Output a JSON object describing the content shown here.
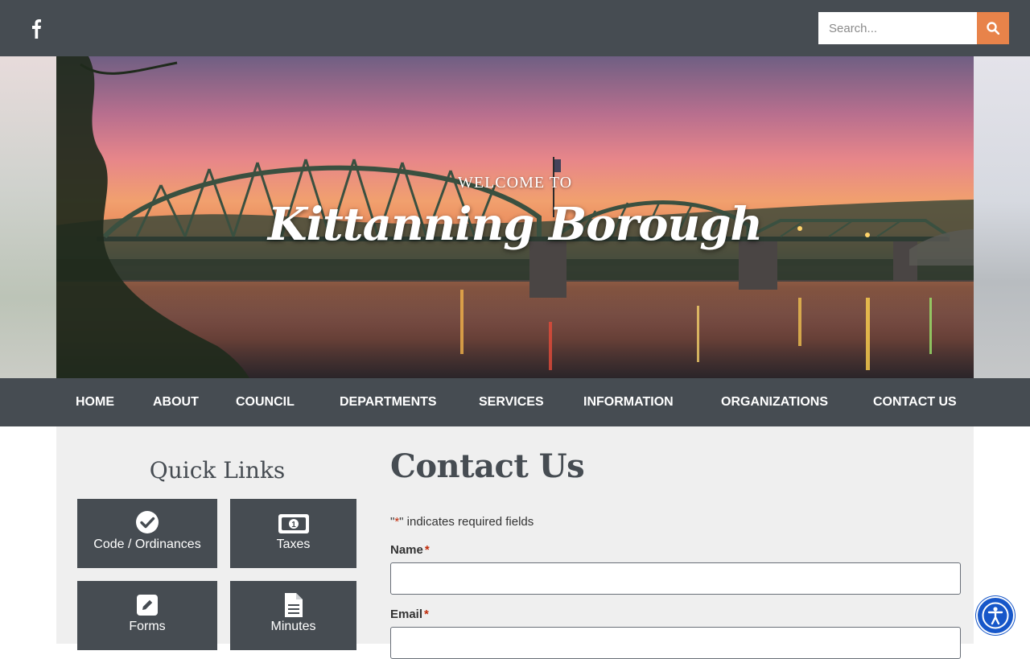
{
  "topbar": {
    "social_icon": "facebook-icon",
    "search": {
      "placeholder": "Search...",
      "button_icon": "search-icon"
    },
    "colors": {
      "bar": "#464c52",
      "search_button": "#e8834a"
    }
  },
  "hero": {
    "welcome": "WELCOME TO",
    "title": "Kittanning Borough"
  },
  "nav": {
    "items": [
      {
        "label": "HOME"
      },
      {
        "label": "ABOUT"
      },
      {
        "label": "COUNCIL"
      },
      {
        "label": "DEPARTMENTS"
      },
      {
        "label": "SERVICES"
      },
      {
        "label": "INFORMATION"
      },
      {
        "label": "ORGANIZATIONS"
      },
      {
        "label": "CONTACT US"
      }
    ]
  },
  "quick_links": {
    "title": "Quick Links",
    "items": [
      {
        "label": "Code / Ordinances",
        "icon": "check-circle-icon"
      },
      {
        "label": "Taxes",
        "icon": "money-bill-icon"
      },
      {
        "label": "Forms",
        "icon": "edit-icon"
      },
      {
        "label": "Minutes",
        "icon": "document-icon"
      }
    ]
  },
  "contact_form": {
    "title": "Contact Us",
    "required_note_prefix": "\"",
    "required_star": "*",
    "required_note_suffix": "\" indicates required fields",
    "fields": [
      {
        "label": "Name",
        "required_mark": "*",
        "value": ""
      },
      {
        "label": "Email",
        "required_mark": "*",
        "value": ""
      }
    ]
  },
  "accessibility": {
    "icon": "accessibility-icon"
  }
}
